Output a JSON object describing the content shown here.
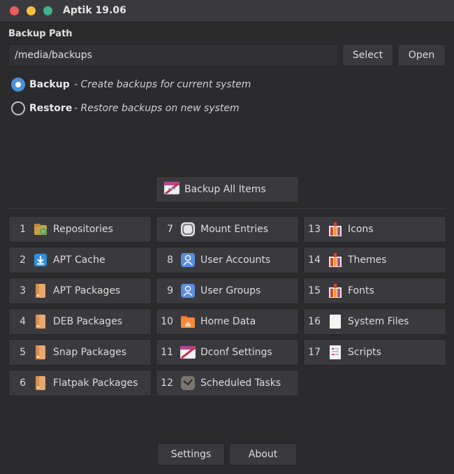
{
  "window": {
    "title": "Aptik 19.06"
  },
  "backup_path": {
    "label": "Backup Path",
    "value": "/media/backups",
    "select_label": "Select",
    "open_label": "Open"
  },
  "mode": {
    "selected": "backup",
    "options": [
      {
        "label": "Backup",
        "description": "- Create backups for current system"
      },
      {
        "label": "Restore",
        "description": "- Restore backups on new system"
      }
    ]
  },
  "backup_all_label": "Backup All Items",
  "items": [
    {
      "num": "1",
      "label": "Repositories",
      "icon": "repositories-icon"
    },
    {
      "num": "2",
      "label": "APT Cache",
      "icon": "download-icon"
    },
    {
      "num": "3",
      "label": "APT Packages",
      "icon": "package-icon"
    },
    {
      "num": "4",
      "label": "DEB Packages",
      "icon": "package-icon"
    },
    {
      "num": "5",
      "label": "Snap Packages",
      "icon": "package-icon"
    },
    {
      "num": "6",
      "label": "Flatpak Packages",
      "icon": "package-icon"
    },
    {
      "num": "7",
      "label": "Mount Entries",
      "icon": "drive-icon"
    },
    {
      "num": "8",
      "label": "User Accounts",
      "icon": "user-icon"
    },
    {
      "num": "9",
      "label": "User Groups",
      "icon": "user-icon"
    },
    {
      "num": "10",
      "label": "Home Data",
      "icon": "home-folder-icon"
    },
    {
      "num": "11",
      "label": "Dconf Settings",
      "icon": "settings-icon"
    },
    {
      "num": "12",
      "label": "Scheduled Tasks",
      "icon": "clock-icon"
    },
    {
      "num": "13",
      "label": "Icons",
      "icon": "gift-icon"
    },
    {
      "num": "14",
      "label": "Themes",
      "icon": "gift-icon"
    },
    {
      "num": "15",
      "label": "Fonts",
      "icon": "gift-icon"
    },
    {
      "num": "16",
      "label": "System Files",
      "icon": "file-icon"
    },
    {
      "num": "17",
      "label": "Scripts",
      "icon": "script-icon"
    }
  ],
  "footer": {
    "settings_label": "Settings",
    "about_label": "About"
  },
  "colors": {
    "accent": "#4a90d9",
    "background": "#2b2b2e",
    "button": "#3a3a3e"
  }
}
